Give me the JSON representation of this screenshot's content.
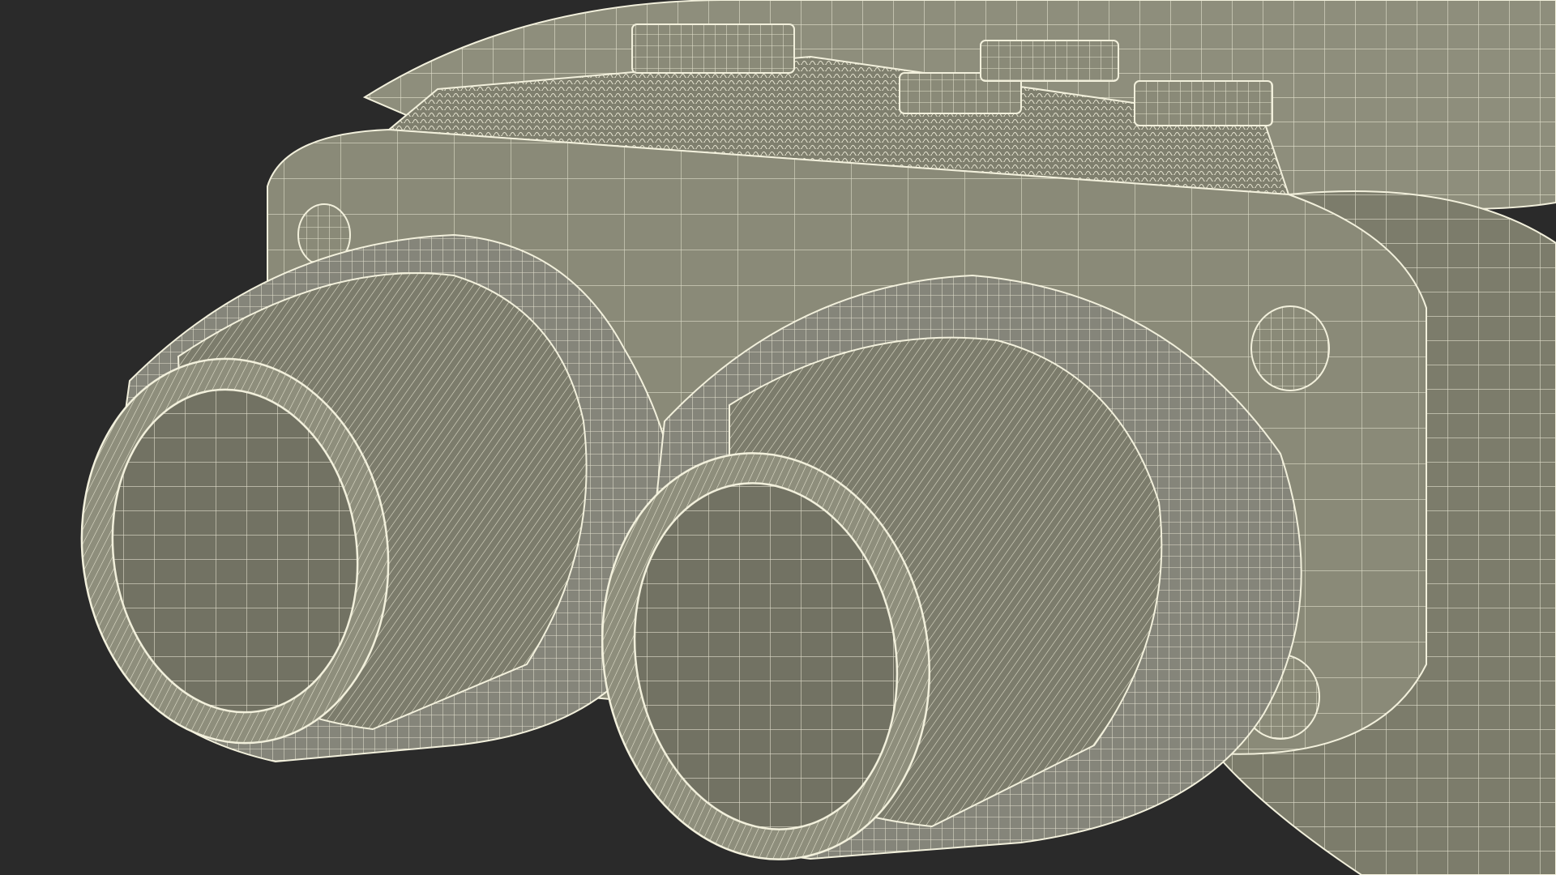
{
  "scene": {
    "subject": "wireframe-binoculars-render",
    "colors": {
      "background": "#2a2a2a",
      "body_fill": "#8a8a78",
      "body_fill_light": "#9a9a88",
      "body_fill_dark": "#6e6e5e",
      "lens_fill": "#727263",
      "wire": "#f2f0dc"
    }
  }
}
